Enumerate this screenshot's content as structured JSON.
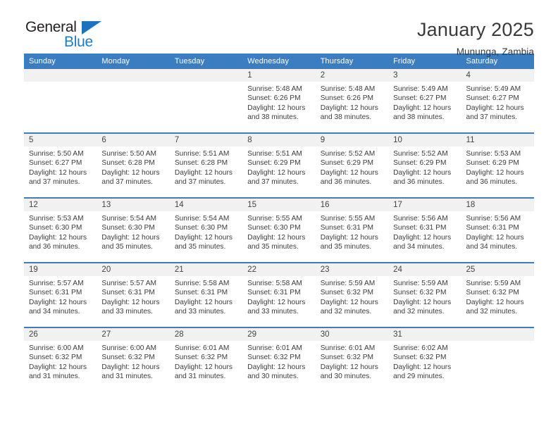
{
  "brand": {
    "name_part1": "General",
    "name_part2": "Blue",
    "logo_icon": "triangle-flag-icon",
    "accent_color": "#1f7cc4"
  },
  "header": {
    "title": "January 2025",
    "location": "Mununga, Zambia"
  },
  "calendar": {
    "header_bg": "#3b7dc1",
    "daynum_bg": "#f1f1f1",
    "weekdays": [
      "Sunday",
      "Monday",
      "Tuesday",
      "Wednesday",
      "Thursday",
      "Friday",
      "Saturday"
    ],
    "labels": {
      "sunrise": "Sunrise:",
      "sunset": "Sunset:",
      "daylight": "Daylight:"
    },
    "weeks": [
      [
        {
          "day": "",
          "empty": true
        },
        {
          "day": "",
          "empty": true
        },
        {
          "day": "",
          "empty": true
        },
        {
          "day": "1",
          "sunrise": "Sunrise: 5:48 AM",
          "sunset": "Sunset: 6:26 PM",
          "daylight": "Daylight: 12 hours and 38 minutes."
        },
        {
          "day": "2",
          "sunrise": "Sunrise: 5:48 AM",
          "sunset": "Sunset: 6:26 PM",
          "daylight": "Daylight: 12 hours and 38 minutes."
        },
        {
          "day": "3",
          "sunrise": "Sunrise: 5:49 AM",
          "sunset": "Sunset: 6:27 PM",
          "daylight": "Daylight: 12 hours and 38 minutes."
        },
        {
          "day": "4",
          "sunrise": "Sunrise: 5:49 AM",
          "sunset": "Sunset: 6:27 PM",
          "daylight": "Daylight: 12 hours and 37 minutes."
        }
      ],
      [
        {
          "day": "5",
          "sunrise": "Sunrise: 5:50 AM",
          "sunset": "Sunset: 6:27 PM",
          "daylight": "Daylight: 12 hours and 37 minutes."
        },
        {
          "day": "6",
          "sunrise": "Sunrise: 5:50 AM",
          "sunset": "Sunset: 6:28 PM",
          "daylight": "Daylight: 12 hours and 37 minutes."
        },
        {
          "day": "7",
          "sunrise": "Sunrise: 5:51 AM",
          "sunset": "Sunset: 6:28 PM",
          "daylight": "Daylight: 12 hours and 37 minutes."
        },
        {
          "day": "8",
          "sunrise": "Sunrise: 5:51 AM",
          "sunset": "Sunset: 6:29 PM",
          "daylight": "Daylight: 12 hours and 37 minutes."
        },
        {
          "day": "9",
          "sunrise": "Sunrise: 5:52 AM",
          "sunset": "Sunset: 6:29 PM",
          "daylight": "Daylight: 12 hours and 36 minutes."
        },
        {
          "day": "10",
          "sunrise": "Sunrise: 5:52 AM",
          "sunset": "Sunset: 6:29 PM",
          "daylight": "Daylight: 12 hours and 36 minutes."
        },
        {
          "day": "11",
          "sunrise": "Sunrise: 5:53 AM",
          "sunset": "Sunset: 6:29 PM",
          "daylight": "Daylight: 12 hours and 36 minutes."
        }
      ],
      [
        {
          "day": "12",
          "sunrise": "Sunrise: 5:53 AM",
          "sunset": "Sunset: 6:30 PM",
          "daylight": "Daylight: 12 hours and 36 minutes."
        },
        {
          "day": "13",
          "sunrise": "Sunrise: 5:54 AM",
          "sunset": "Sunset: 6:30 PM",
          "daylight": "Daylight: 12 hours and 35 minutes."
        },
        {
          "day": "14",
          "sunrise": "Sunrise: 5:54 AM",
          "sunset": "Sunset: 6:30 PM",
          "daylight": "Daylight: 12 hours and 35 minutes."
        },
        {
          "day": "15",
          "sunrise": "Sunrise: 5:55 AM",
          "sunset": "Sunset: 6:30 PM",
          "daylight": "Daylight: 12 hours and 35 minutes."
        },
        {
          "day": "16",
          "sunrise": "Sunrise: 5:55 AM",
          "sunset": "Sunset: 6:31 PM",
          "daylight": "Daylight: 12 hours and 35 minutes."
        },
        {
          "day": "17",
          "sunrise": "Sunrise: 5:56 AM",
          "sunset": "Sunset: 6:31 PM",
          "daylight": "Daylight: 12 hours and 34 minutes."
        },
        {
          "day": "18",
          "sunrise": "Sunrise: 5:56 AM",
          "sunset": "Sunset: 6:31 PM",
          "daylight": "Daylight: 12 hours and 34 minutes."
        }
      ],
      [
        {
          "day": "19",
          "sunrise": "Sunrise: 5:57 AM",
          "sunset": "Sunset: 6:31 PM",
          "daylight": "Daylight: 12 hours and 34 minutes."
        },
        {
          "day": "20",
          "sunrise": "Sunrise: 5:57 AM",
          "sunset": "Sunset: 6:31 PM",
          "daylight": "Daylight: 12 hours and 33 minutes."
        },
        {
          "day": "21",
          "sunrise": "Sunrise: 5:58 AM",
          "sunset": "Sunset: 6:31 PM",
          "daylight": "Daylight: 12 hours and 33 minutes."
        },
        {
          "day": "22",
          "sunrise": "Sunrise: 5:58 AM",
          "sunset": "Sunset: 6:31 PM",
          "daylight": "Daylight: 12 hours and 33 minutes."
        },
        {
          "day": "23",
          "sunrise": "Sunrise: 5:59 AM",
          "sunset": "Sunset: 6:32 PM",
          "daylight": "Daylight: 12 hours and 32 minutes."
        },
        {
          "day": "24",
          "sunrise": "Sunrise: 5:59 AM",
          "sunset": "Sunset: 6:32 PM",
          "daylight": "Daylight: 12 hours and 32 minutes."
        },
        {
          "day": "25",
          "sunrise": "Sunrise: 5:59 AM",
          "sunset": "Sunset: 6:32 PM",
          "daylight": "Daylight: 12 hours and 32 minutes."
        }
      ],
      [
        {
          "day": "26",
          "sunrise": "Sunrise: 6:00 AM",
          "sunset": "Sunset: 6:32 PM",
          "daylight": "Daylight: 12 hours and 31 minutes."
        },
        {
          "day": "27",
          "sunrise": "Sunrise: 6:00 AM",
          "sunset": "Sunset: 6:32 PM",
          "daylight": "Daylight: 12 hours and 31 minutes."
        },
        {
          "day": "28",
          "sunrise": "Sunrise: 6:01 AM",
          "sunset": "Sunset: 6:32 PM",
          "daylight": "Daylight: 12 hours and 31 minutes."
        },
        {
          "day": "29",
          "sunrise": "Sunrise: 6:01 AM",
          "sunset": "Sunset: 6:32 PM",
          "daylight": "Daylight: 12 hours and 30 minutes."
        },
        {
          "day": "30",
          "sunrise": "Sunrise: 6:01 AM",
          "sunset": "Sunset: 6:32 PM",
          "daylight": "Daylight: 12 hours and 30 minutes."
        },
        {
          "day": "31",
          "sunrise": "Sunrise: 6:02 AM",
          "sunset": "Sunset: 6:32 PM",
          "daylight": "Daylight: 12 hours and 29 minutes."
        },
        {
          "day": "",
          "empty": true
        }
      ]
    ]
  }
}
